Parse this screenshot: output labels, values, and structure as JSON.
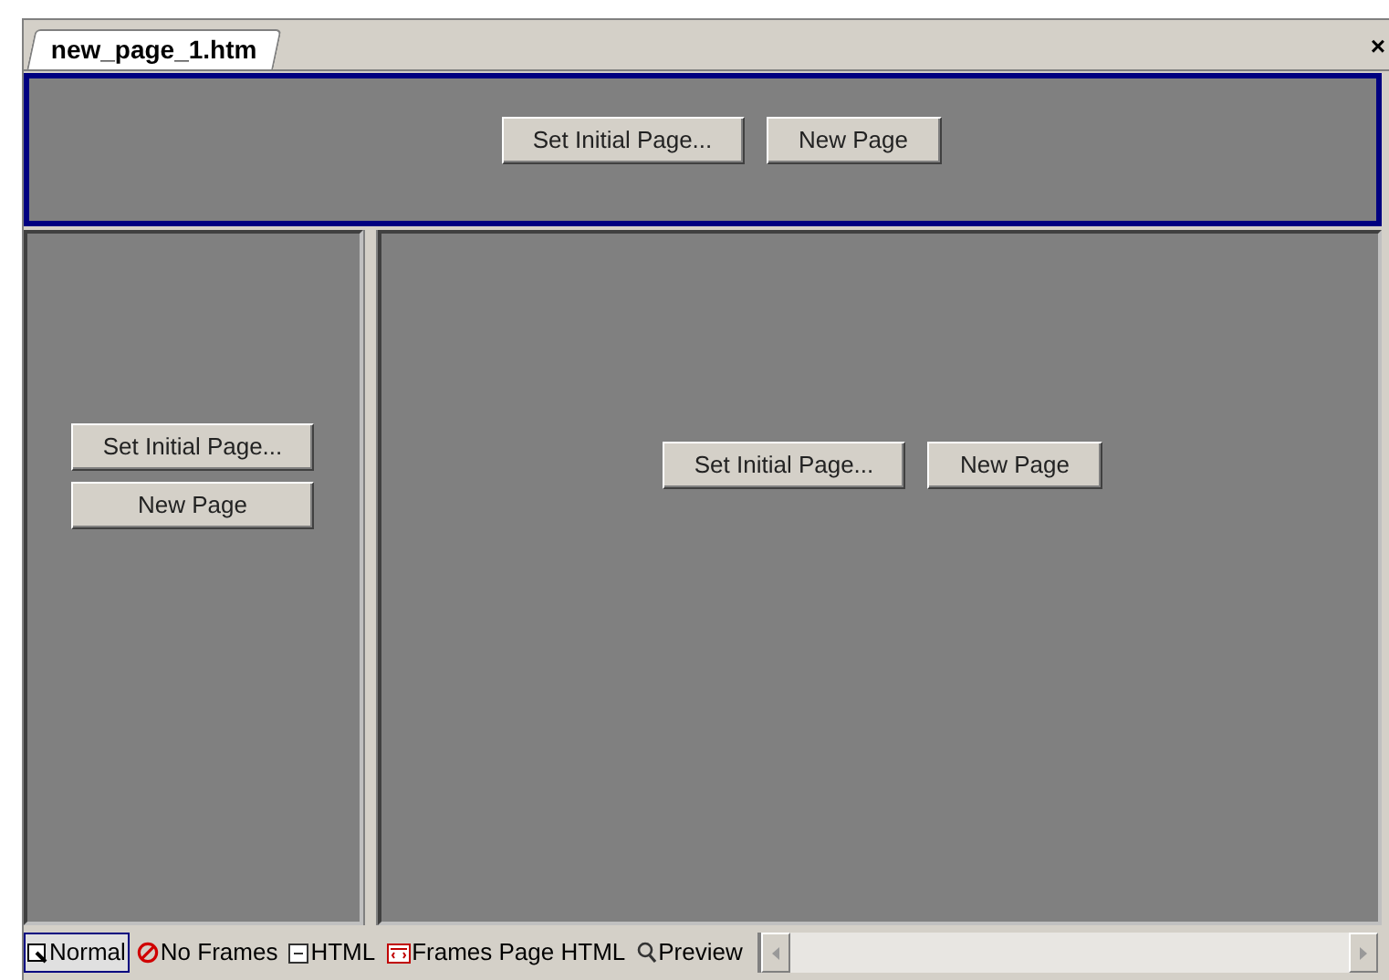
{
  "document_tabs": [
    {
      "label": "new_page_1.htm",
      "selected": true
    }
  ],
  "close_button": "×",
  "frames": {
    "top": {
      "selected": true,
      "buttons": [
        "Set Initial Page...",
        "New Page"
      ]
    },
    "left": {
      "selected": false,
      "buttons": [
        "Set Initial Page...",
        "New Page"
      ]
    },
    "right": {
      "selected": false,
      "buttons": [
        "Set Initial Page...",
        "New Page"
      ]
    }
  },
  "view_tabs": [
    {
      "label": "Normal",
      "kind": "normal",
      "selected": true
    },
    {
      "label": "No Frames",
      "kind": "noframes",
      "selected": false
    },
    {
      "label": "HTML",
      "kind": "html",
      "selected": false
    },
    {
      "label": "Frames Page HTML",
      "kind": "frameshtml",
      "selected": false
    },
    {
      "label": "Preview",
      "kind": "preview",
      "selected": false
    }
  ]
}
